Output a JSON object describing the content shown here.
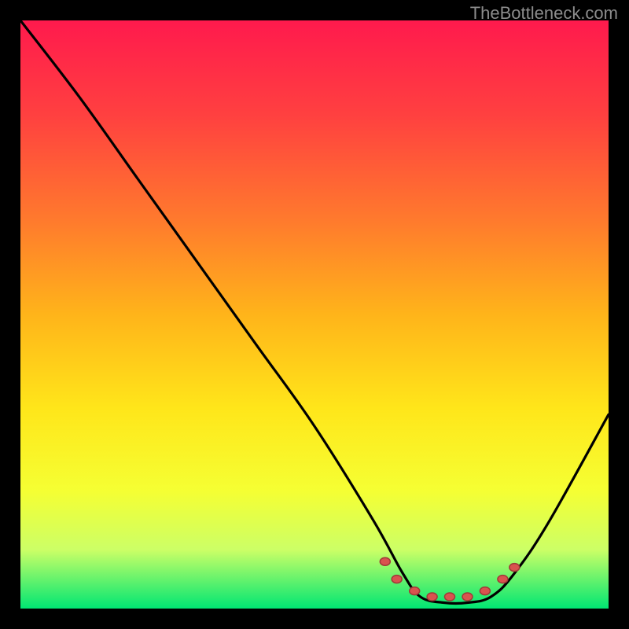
{
  "watermark": "TheBottleneck.com",
  "chart_data": {
    "type": "line",
    "title": "",
    "xlabel": "",
    "ylabel": "",
    "xlim": [
      0,
      100
    ],
    "ylim": [
      0,
      100
    ],
    "series": [
      {
        "name": "bottleneck-curve",
        "x": [
          0,
          10,
          20,
          30,
          40,
          50,
          60,
          65,
          68,
          72,
          76,
          80,
          84,
          90,
          100
        ],
        "values": [
          100,
          87,
          73,
          59,
          45,
          31,
          15,
          6,
          2,
          1,
          1,
          2,
          6,
          15,
          33
        ]
      }
    ],
    "optimal_points": {
      "name": "optimal-range",
      "x": [
        62,
        64,
        67,
        70,
        73,
        76,
        79,
        82,
        84
      ],
      "values": [
        8,
        5,
        3,
        2,
        2,
        2,
        3,
        5,
        7
      ]
    },
    "colors": {
      "gradient_top": "#ff1a4d",
      "gradient_bottom": "#00e673",
      "curve": "#000000",
      "dots_fill": "#d9534f",
      "dots_stroke": "#a03a38",
      "background_outer": "#000000",
      "watermark": "#8c8c8c"
    }
  }
}
